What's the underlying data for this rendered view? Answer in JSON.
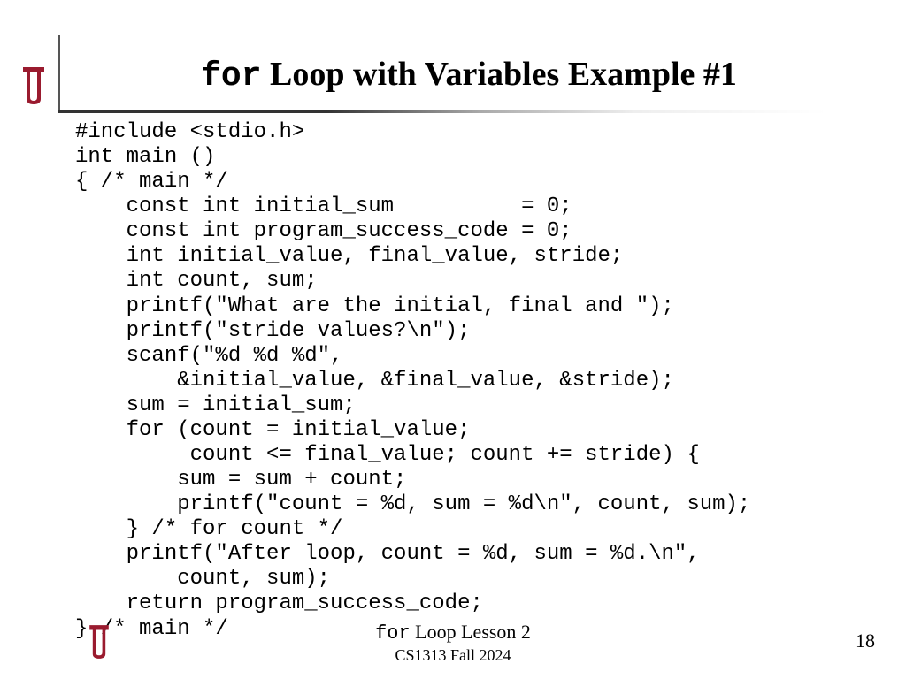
{
  "title": {
    "mono_part": "for",
    "rest": " Loop with Variables Example #1"
  },
  "code": "#include <stdio.h>\nint main ()\n{ /* main */\n    const int initial_sum          = 0;\n    const int program_success_code = 0;\n    int initial_value, final_value, stride;\n    int count, sum;\n    printf(\"What are the initial, final and \");\n    printf(\"stride values?\\n\");\n    scanf(\"%d %d %d\",\n        &initial_value, &final_value, &stride);\n    sum = initial_sum;\n    for (count = initial_value;\n         count <= final_value; count += stride) {\n        sum = sum + count;\n        printf(\"count = %d, sum = %d\\n\", count, sum);\n    } /* for count */\n    printf(\"After loop, count = %d, sum = %d.\\n\",\n        count, sum);\n    return program_success_code;\n} /* main */",
  "footer": {
    "line1_mono": "for",
    "line1_rest": " Loop Lesson 2",
    "line2": "CS1313 Fall 2024"
  },
  "page_number": "18",
  "brand_color": "#9a1b2f"
}
